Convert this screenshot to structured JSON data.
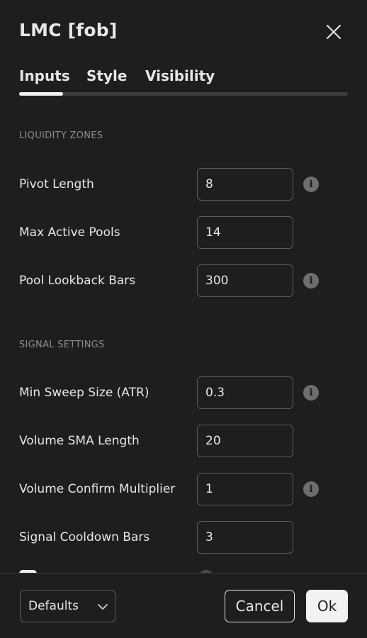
{
  "dialog": {
    "title": "LMC [fob]",
    "close_icon": "close-icon"
  },
  "tabs": [
    {
      "label": "Inputs",
      "active": true
    },
    {
      "label": "Style",
      "active": false
    },
    {
      "label": "Visibility",
      "active": false
    }
  ],
  "sections": {
    "liquidity": {
      "title": "LIQUIDITY ZONES",
      "rows": [
        {
          "label": "Pivot Length",
          "value": "8",
          "info": true
        },
        {
          "label": "Max Active Pools",
          "value": "14",
          "info": false
        },
        {
          "label": "Pool Lookback Bars",
          "value": "300",
          "info": true
        }
      ]
    },
    "signal": {
      "title": "SIGNAL SETTINGS",
      "rows": [
        {
          "label": "Min Sweep Size (ATR)",
          "value": "0.3",
          "info": true
        },
        {
          "label": "Volume SMA Length",
          "value": "20",
          "info": false
        },
        {
          "label": "Volume Confirm Multiplier",
          "value": "1",
          "info": true
        },
        {
          "label": "Signal Cooldown Bars",
          "value": "3",
          "info": false
        }
      ]
    }
  },
  "footer": {
    "defaults_label": "Defaults",
    "cancel_label": "Cancel",
    "ok_label": "Ok"
  },
  "colors": {
    "background": "#1e1e1e",
    "text": "#e6e6e6",
    "muted": "#8c8c8c",
    "border": "#5b5b5b",
    "ok_button": "#f2f2f2"
  }
}
